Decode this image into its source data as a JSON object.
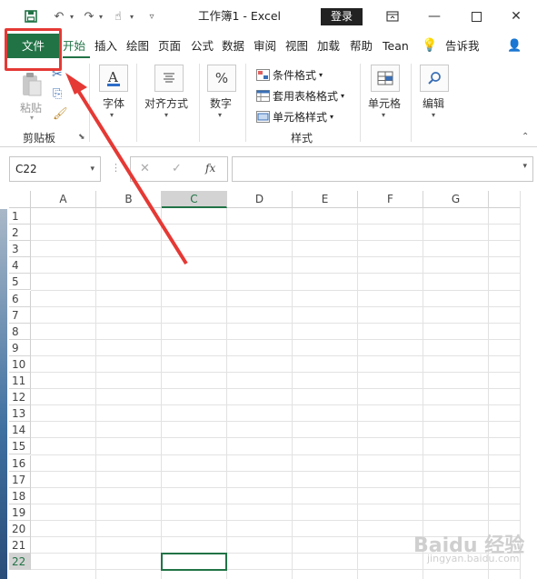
{
  "titlebar": {
    "title": "工作簿1  -  Excel",
    "login": "登录"
  },
  "tabs": {
    "file": "文件",
    "items": [
      "开始",
      "插入",
      "绘图",
      "页面",
      "公式",
      "数据",
      "审阅",
      "视图",
      "加载",
      "帮助",
      "Tean",
      "告诉我"
    ],
    "active": "开始"
  },
  "ribbon": {
    "paste": "粘贴",
    "clipboard": "剪贴板",
    "font": "字体",
    "align": "对齐方式",
    "number": "数字",
    "cond_format": "条件格式",
    "table_format": "套用表格格式",
    "cell_style": "单元格样式",
    "styles": "样式",
    "cells": "单元格",
    "edit": "编辑"
  },
  "formula_bar": {
    "name_box": "C22",
    "fx": "fx",
    "formula": ""
  },
  "grid": {
    "columns": [
      "A",
      "B",
      "C",
      "D",
      "E",
      "F",
      "G"
    ],
    "selected_column": "C",
    "rows": [
      "1",
      "2",
      "3",
      "4",
      "5",
      "6",
      "7",
      "8",
      "9",
      "10",
      "11",
      "12",
      "13",
      "14",
      "15",
      "16",
      "17",
      "18",
      "19",
      "20",
      "21",
      "22"
    ],
    "selected_row": "22"
  },
  "watermark": {
    "brand": "Baidu 经验",
    "sub": "jingyan.baidu.com"
  },
  "colors": {
    "accent": "#217346",
    "annotation": "#e53935"
  }
}
